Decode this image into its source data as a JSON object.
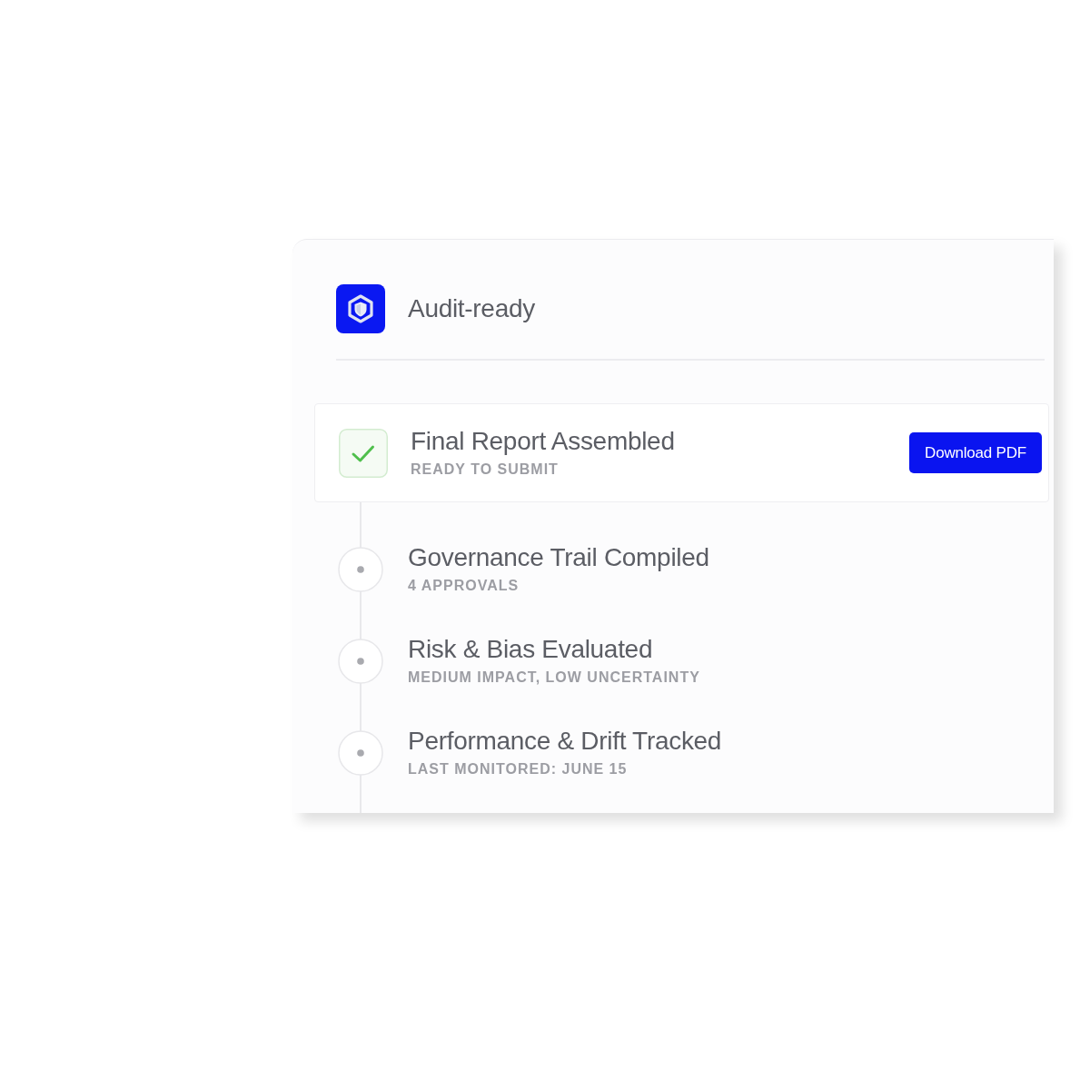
{
  "header": {
    "title": "Audit-ready"
  },
  "steps": [
    {
      "title": "Final Report Assembled",
      "subtitle": "READY TO SUBMIT",
      "done": true,
      "action": "Download PDF"
    },
    {
      "title": "Governance Trail Compiled",
      "subtitle": "4 APPROVALS",
      "done": false
    },
    {
      "title": "Risk & Bias Evaluated",
      "subtitle": "MEDIUM IMPACT, LOW UNCERTAINTY",
      "done": false
    },
    {
      "title": "Performance & Drift Tracked",
      "subtitle": "LAST MONITORED: JUNE 15",
      "done": false
    }
  ]
}
